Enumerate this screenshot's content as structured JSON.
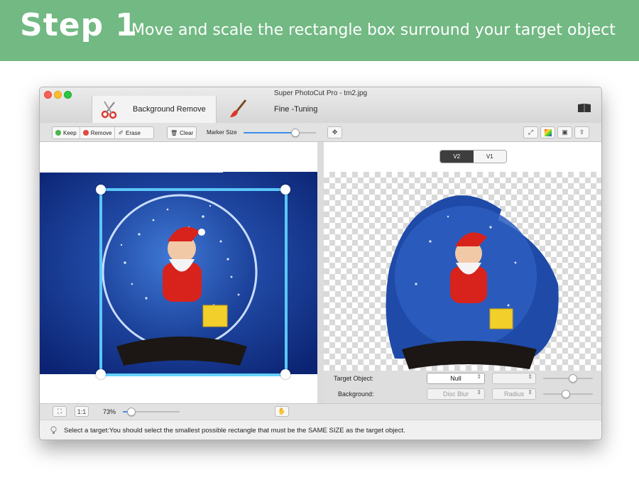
{
  "banner": {
    "step": "Step 1",
    "subtitle": "Move and scale the rectangle box surround your target object"
  },
  "window": {
    "title": "Super PhotoCut Pro - tm2.jpg",
    "tabs": [
      {
        "label": "Background Remove",
        "icon": "scissors-icon",
        "active": true
      },
      {
        "label": "Fine -Tuning",
        "icon": "paintbrush-icon",
        "active": false
      }
    ],
    "help_icon": "book-icon"
  },
  "toolbar": {
    "keep_label": "Keep",
    "remove_label": "Remove",
    "erase_label": "Erase",
    "clear_label": "Clear",
    "marker_size_label": "Marker Size",
    "marker_size_value": 0.72,
    "right_icons": [
      "fit-image-icon",
      "color-picker-icon",
      "background-image-icon",
      "export-icon"
    ],
    "accent_color": "#3b8ee8"
  },
  "left_pane": {
    "image": "santa-snow-globe"
  },
  "right_pane": {
    "versions": [
      "V2",
      "V1"
    ],
    "active_version": "V2",
    "target_object_label": "Target Object:",
    "target_object_value": "Null",
    "background_label": "Background:",
    "background_value": "Disc Blur",
    "radius_value": "Radius",
    "target_slider_value": 0.6,
    "background_slider_value": 0.45
  },
  "bottom_bar": {
    "one_to_one_label": "1:1",
    "zoom": "73%",
    "zoom_value": 0.15
  },
  "status": {
    "text": "Select a target:You should select the smallest possible rectangle that must be the SAME SIZE as the target object."
  },
  "colors": {
    "banner": "#72b983",
    "selection": "#5fd0ff"
  }
}
